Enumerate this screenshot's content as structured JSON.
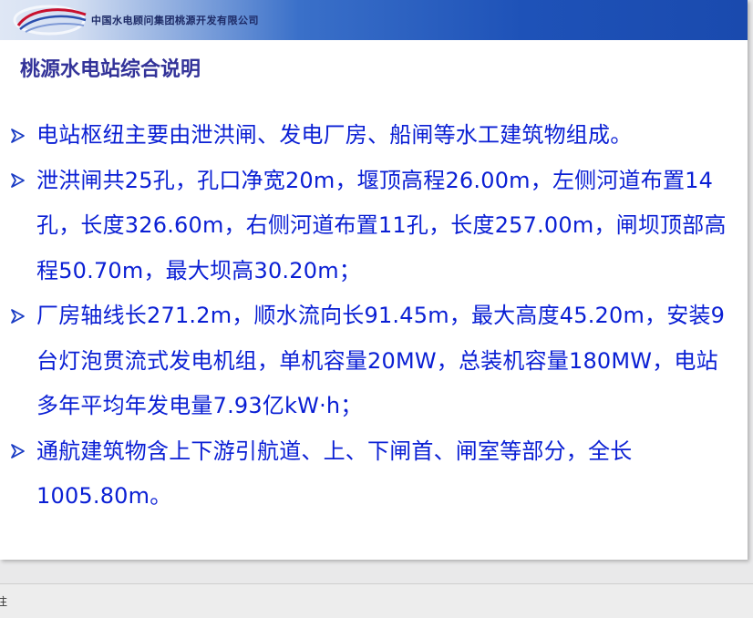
{
  "header": {
    "company_name": "中国水电顾问集团桃源开发有限公司"
  },
  "slide": {
    "title": "桃源水电站综合说明",
    "bullets": [
      {
        "text": "电站枢纽主要由泄洪闸、发电厂房、船闸等水工建筑物组成。"
      },
      {
        "text": "泄洪闸共25孔，孔口净宽20m，堰顶高程26.00m，左侧河道布置14孔，长度326.60m，右侧河道布置11孔，长度257.00m，闸坝顶部高程50.70m，最大坝高30.20m；"
      },
      {
        "text": "厂房轴线长271.2m，顺水流向长91.45m，最大高度45.20m，安装9台灯泡贯流式发电机组，单机容量20MW，总装机容量180MW，电站多年平均年发电量7.93亿kW·h；"
      },
      {
        "text": "通航建筑物含上下游引航道、上、下闸首、闸室等部分，全长1005.80m。"
      }
    ]
  },
  "notes": {
    "label": "注"
  },
  "colors": {
    "bullet_text": "#0a1fd4",
    "title": "#333399",
    "banner_dark": "#1a4aae",
    "bullet_marker": "#1a3cc4"
  },
  "icons": {
    "bullet": "arrow-bullet-icon",
    "logo": "swoosh-logo-icon"
  }
}
